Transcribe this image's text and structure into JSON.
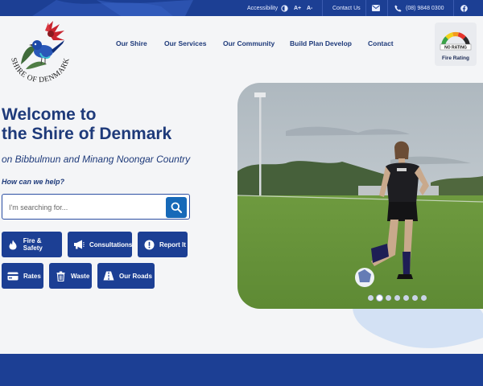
{
  "topbar": {
    "accessibility": "Accessibility",
    "font_increase": "A+",
    "font_decrease": "A-",
    "contact_us": "Contact Us",
    "phone": "(08) 9848 0300"
  },
  "logo": {
    "text": "SHIRE OF DENMARK"
  },
  "nav": {
    "items": [
      "Our Shire",
      "Our Services",
      "Our Community",
      "Build Plan Develop",
      "Contact"
    ]
  },
  "fire_rating": {
    "status": "NO RATING",
    "label": "Fire Rating"
  },
  "hero": {
    "title_line1": "Welcome to",
    "title_line2": "the Shire of Denmark",
    "subtitle": "on Bibbulmun and Minang Noongar Country",
    "help_heading": "How can we help?",
    "search_placeholder": "I'm searching for..."
  },
  "quick_links": [
    {
      "label": "Fire & Safety",
      "icon": "flame-icon"
    },
    {
      "label": "Consultations",
      "icon": "megaphone-icon"
    },
    {
      "label": "Report It",
      "icon": "alert-icon"
    },
    {
      "label": "Rates",
      "icon": "credit-card-icon"
    },
    {
      "label": "Waste",
      "icon": "trash-icon"
    },
    {
      "label": "Our Roads",
      "icon": "road-icon"
    }
  ],
  "carousel": {
    "slide_count": 7,
    "active_index": 1
  },
  "colors": {
    "brand_navy": "#1c3f94",
    "search_button": "#1669b8",
    "text_navy": "#1e3a7a"
  }
}
